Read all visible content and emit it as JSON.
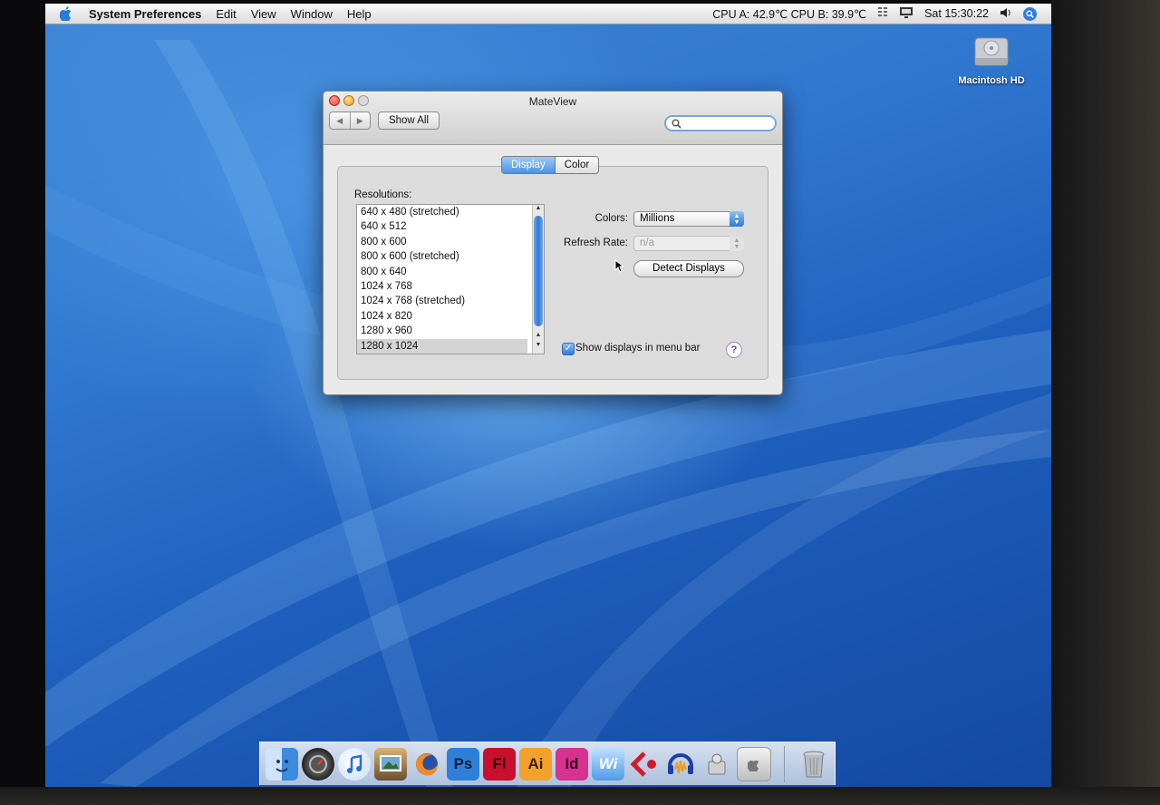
{
  "menubar": {
    "app_name": "System Preferences",
    "menus": [
      "Edit",
      "View",
      "Window",
      "Help"
    ],
    "cpu_status": "CPU A: 42.9℃ CPU B: 39.9℃",
    "clock": "Sat 15:30:22"
  },
  "desktop": {
    "hd_label": "Macintosh HD"
  },
  "window": {
    "title": "MateView",
    "show_all": "Show All",
    "tabs": [
      "Display",
      "Color"
    ],
    "active_tab": "Display",
    "resolutions_label": "Resolutions:",
    "resolutions": [
      "640 x 480 (stretched)",
      "640 x 512",
      "800 x 600",
      "800 x 600 (stretched)",
      "800 x 640",
      "1024 x 768",
      "1024 x 768 (stretched)",
      "1024 x 820",
      "1280 x 960",
      "1280 x 1024"
    ],
    "selected_resolution": "1280 x 1024",
    "colors_label": "Colors:",
    "colors_value": "Millions",
    "refresh_label": "Refresh Rate:",
    "refresh_value": "n/a",
    "detect_button": "Detect Displays",
    "show_in_menubar": "Show displays in menu bar",
    "show_in_menubar_checked": true,
    "help": "?"
  },
  "dock": {
    "icons": [
      "finder",
      "dashboard",
      "itunes",
      "iphoto",
      "firefox",
      "Ps",
      "Fl",
      "Ai",
      "Id",
      "Wi",
      "Ce",
      "audacity",
      "script",
      "system-preferences",
      "trash"
    ]
  },
  "colors": {
    "accent": "#2f79d6",
    "ps": "#2d7fd8",
    "fl": "#c8102e",
    "ai": "#f3a12a",
    "id": "#d5338f"
  }
}
